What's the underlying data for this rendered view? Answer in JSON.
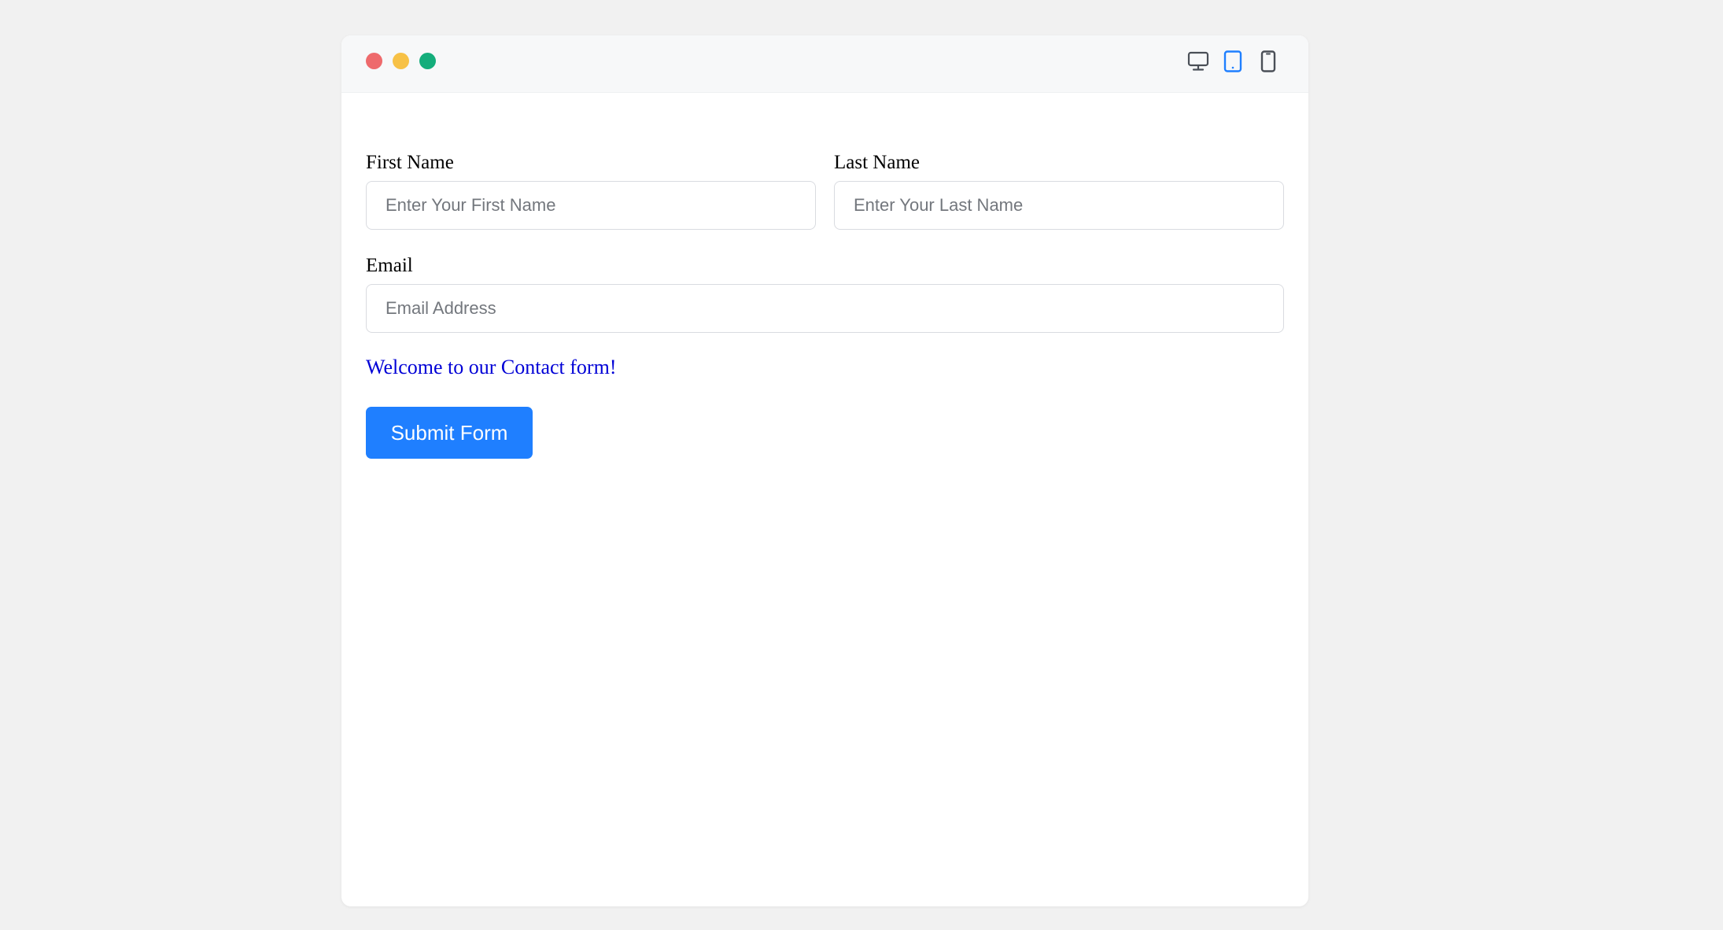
{
  "window": {
    "traffic_lights": {
      "close": {
        "icon": "close-dot-icon",
        "color": "#ee6a6c"
      },
      "minimize": {
        "icon": "minimize-dot-icon",
        "color": "#f7c146"
      },
      "maximize": {
        "icon": "maximize-dot-icon",
        "color": "#14ad7b"
      }
    },
    "device_toggle": {
      "selected": "tablet",
      "items": [
        {
          "id": "desktop",
          "icon": "desktop-monitor-icon"
        },
        {
          "id": "tablet",
          "icon": "tablet-icon"
        },
        {
          "id": "mobile",
          "icon": "mobile-phone-icon"
        }
      ],
      "active_color": "#1f7fff",
      "inactive_color": "#4a4f57"
    }
  },
  "form": {
    "first_name": {
      "label": "First Name",
      "value": "",
      "placeholder": "Enter Your First Name"
    },
    "last_name": {
      "label": "Last Name",
      "value": "",
      "placeholder": "Enter Your Last Name"
    },
    "email": {
      "label": "Email",
      "value": "",
      "placeholder": "Email Address"
    },
    "welcome_text": "Welcome to our Contact form!",
    "welcome_color": "#0000d6",
    "submit_label": "Submit Form",
    "submit_color": "#1f7fff"
  }
}
